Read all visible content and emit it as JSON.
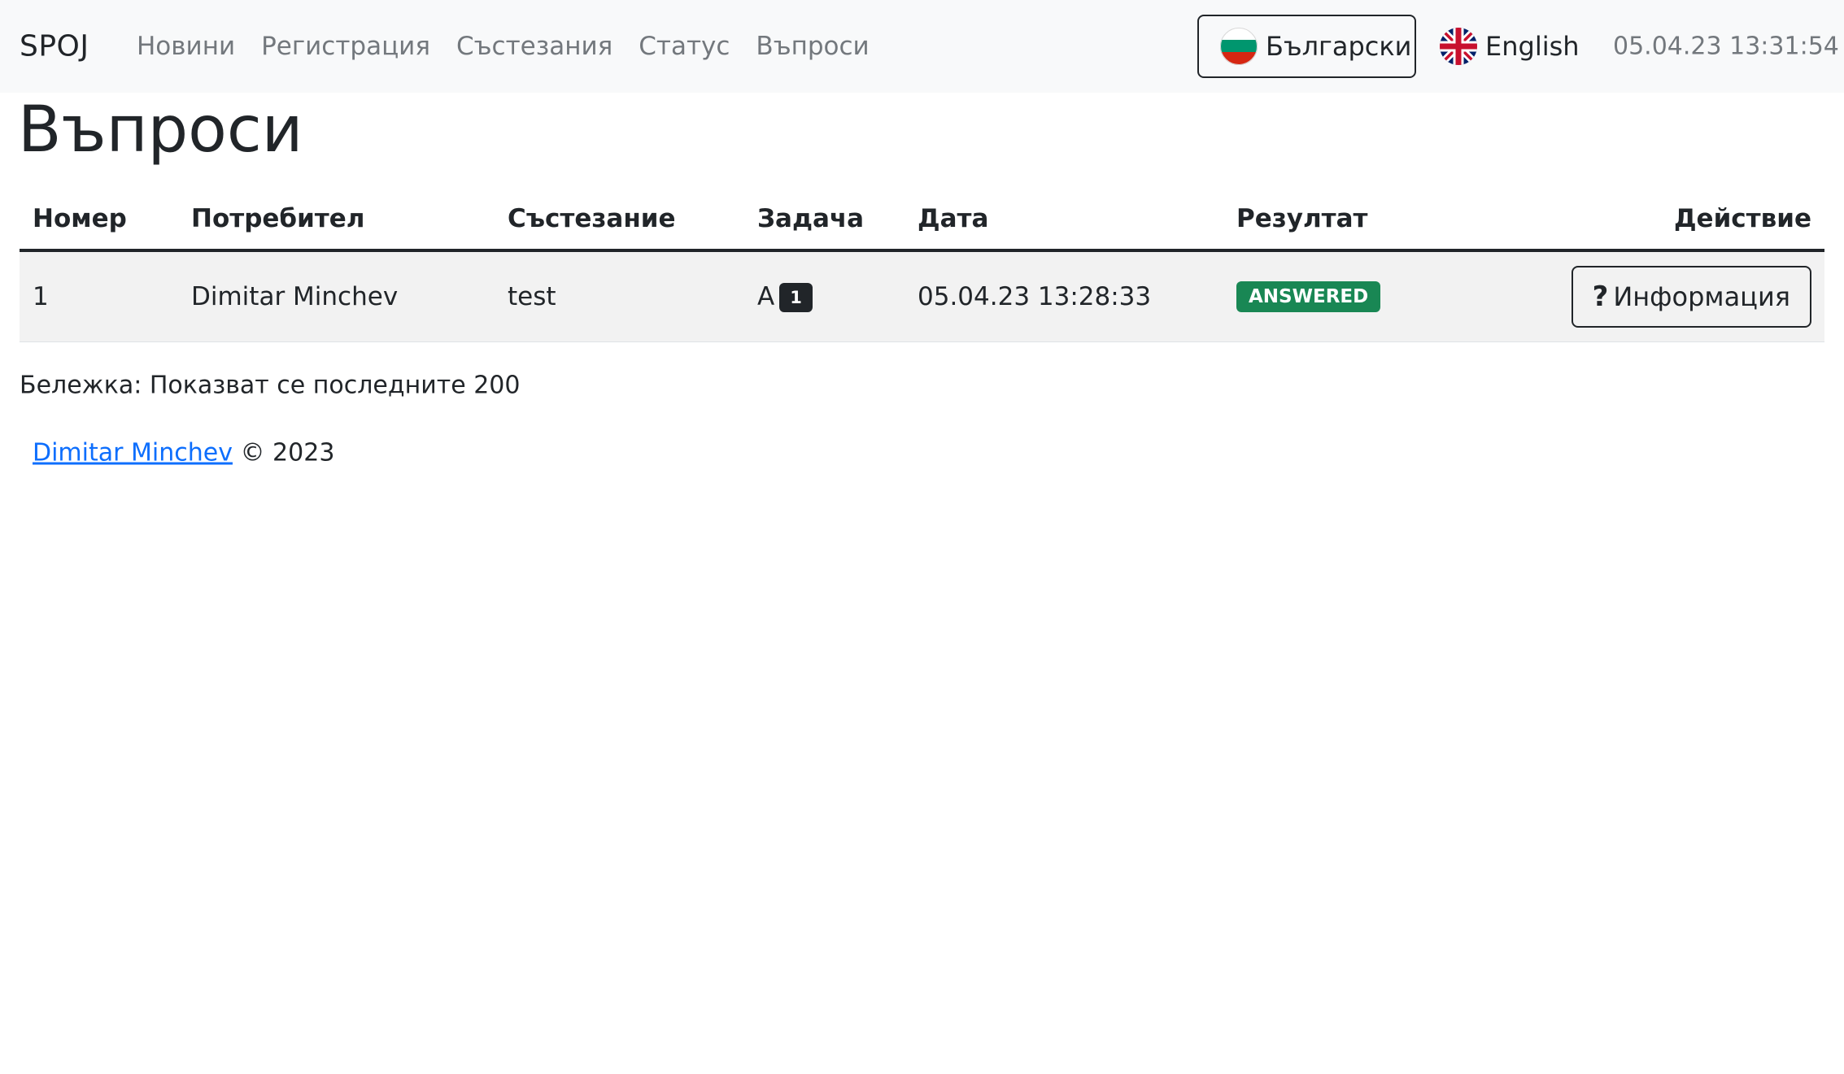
{
  "navbar": {
    "brand": "SPOJ",
    "links": [
      {
        "label": "Новини"
      },
      {
        "label": "Регистрация"
      },
      {
        "label": "Състезания"
      },
      {
        "label": "Статус"
      },
      {
        "label": "Въпроси"
      }
    ],
    "languages": [
      {
        "label": "Български",
        "flag_icon": "bulgaria-flag-icon",
        "active": true
      },
      {
        "label": "English",
        "flag_icon": "uk-flag-icon",
        "active": false
      }
    ],
    "clock": "05.04.23 13:31:54"
  },
  "page": {
    "title": "Въпроси"
  },
  "table": {
    "headers": [
      "Номер",
      "Потребител",
      "Състезание",
      "Задача",
      "Дата",
      "Резултат",
      "Действие"
    ],
    "rows": [
      {
        "number": "1",
        "user": "Dimitar Minchev",
        "contest": "test",
        "task_letter": "A",
        "task_badge": "1",
        "date": "05.04.23 13:28:33",
        "result": "ANSWERED",
        "action_icon": "question-mark-icon",
        "action_label": "Информация"
      }
    ]
  },
  "note": "Бележка: Показват се последните 200",
  "footer": {
    "author": "Dimitar Minchev",
    "copyright": "© 2023"
  },
  "colors": {
    "navbar_bg": "#f8f9fa",
    "nav_link": "#73787d",
    "answered_badge": "#198754",
    "task_badge": "#212529",
    "link": "#0d6efd",
    "row_bg": "#f2f2f2"
  }
}
